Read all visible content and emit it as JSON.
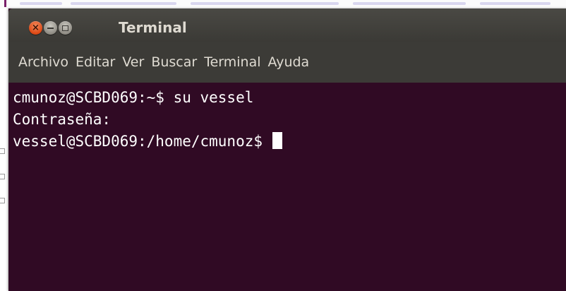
{
  "window": {
    "title": "Terminal"
  },
  "menubar": {
    "items": [
      "Archivo",
      "Editar",
      "Ver",
      "Buscar",
      "Terminal",
      "Ayuda"
    ]
  },
  "terminal": {
    "lines": [
      "cmunoz@SCBD069:~$ su vessel",
      "Contraseña:"
    ],
    "prompt": "vessel@SCBD069:/home/cmunoz$"
  },
  "colors": {
    "terminal_bg": "#300a24",
    "titlebar_bg": "#3c3b37",
    "close_button": "#dd4814",
    "text": "#ffffff"
  },
  "icons": [
    "close-icon",
    "minimize-icon",
    "maximize-icon"
  ]
}
